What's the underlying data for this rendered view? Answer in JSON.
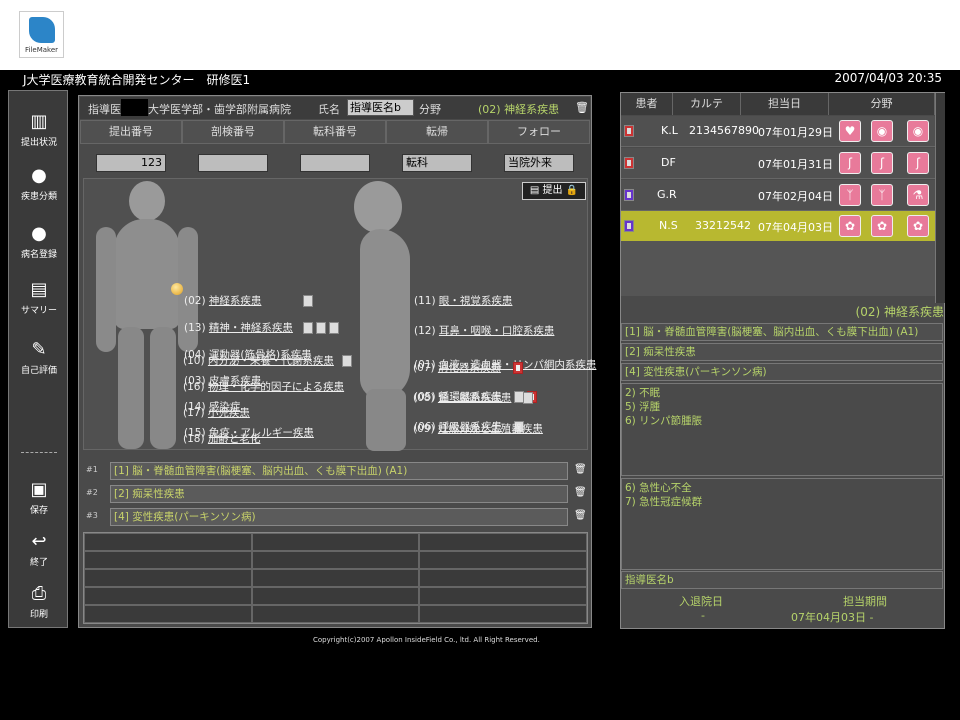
{
  "app": {
    "logo_text": "FileMaker",
    "title": "J大学医療教育統合開発センター　研修医1",
    "datetime": "2007/04/03 20:35"
  },
  "sidebar": [
    {
      "name": "submission-status",
      "label": "提出状況",
      "icon": "bar-chart-icon"
    },
    {
      "name": "disease-class",
      "label": "疾患分類",
      "icon": "people-icon"
    },
    {
      "name": "disease-register",
      "label": "病名登録",
      "icon": "person-icon"
    },
    {
      "name": "summary",
      "label": "サマリー",
      "icon": "document-icon"
    },
    {
      "name": "self-eval",
      "label": "自己評価",
      "icon": "pencil-doc-icon"
    },
    {
      "name": "save",
      "label": "保存",
      "icon": "floppy-icon"
    },
    {
      "name": "exit",
      "label": "終了",
      "icon": "return-arrow-icon"
    },
    {
      "name": "print",
      "label": "印刷",
      "icon": "printer-icon"
    }
  ],
  "header": {
    "supervisor_label": "指導医",
    "institution": "大学医学部・歯学部附属病院",
    "name_label": "氏名",
    "name_value": "指導医名b",
    "field_label": "分野",
    "field_value": "(02) 神経系疾患"
  },
  "columns": [
    "提出番号",
    "剖検番号",
    "転科番号",
    "転帰",
    "フォロー"
  ],
  "column_values": [
    "123",
    "",
    "",
    "転科",
    "当院外来"
  ],
  "submit_label": "提出",
  "categories_left": [
    {
      "label": "(02)",
      "text": "神経系疾患",
      "docs": 1
    },
    {
      "label": "(13)",
      "text": "精神・神経系疾患",
      "docs": 3
    },
    {
      "label": "(04)",
      "text": "運動器(筋骨格)系疾患",
      "docs": 0
    },
    {
      "label": "(03)",
      "text": "皮膚系疾患",
      "docs": 0
    },
    {
      "label": "(14)",
      "text": "感染症",
      "docs": 0
    },
    {
      "label": "(15)",
      "text": "免疫・アレルギー疾患",
      "docs": 0
    },
    {
      "label": "(10)",
      "text": "内分泌・栄養・代謝系疾患",
      "docs": 1
    },
    {
      "label": "(16)",
      "text": "物理・化学的因子による疾患",
      "docs": 0
    },
    {
      "label": "(17)",
      "text": "小児疾患",
      "docs": 0
    },
    {
      "label": "(18)",
      "text": "加齢と老化",
      "docs": 0
    }
  ],
  "categories_right": [
    {
      "label": "(11)",
      "text": "眼・視覚系疾患",
      "docs": 0
    },
    {
      "label": "(12)",
      "text": "耳鼻・咽喉・口腔系疾患",
      "docs": 0
    },
    {
      "label": "(01)",
      "text": "血液・造血器・リンパ網内系疾患",
      "docs": 0
    },
    {
      "label": "(05)",
      "text": "循環器系疾患",
      "docs": 2
    },
    {
      "label": "(06)",
      "text": "呼吸器系疾患",
      "docs": 1
    },
    {
      "label": "(07)",
      "text": "消化器系疾患",
      "docs": 1
    },
    {
      "label": "(08)",
      "text": "腎・尿路系疾患",
      "docs": 1
    },
    {
      "label": "(09)",
      "text": "妊娠分娩と生殖器疾患",
      "docs": 0
    }
  ],
  "diagnoses": [
    {
      "num": "#1",
      "text": "[1] 脳・脊髄血管障害(脳梗塞、脳内出血、くも膜下出血) (A1)"
    },
    {
      "num": "#2",
      "text": "[2] 痴呆性疾患"
    },
    {
      "num": "#3",
      "text": "[4] 変性疾患(パーキンソン病)"
    }
  ],
  "patients_header": [
    "患者",
    "カルテ",
    "担当日",
    "分野"
  ],
  "patients": [
    {
      "name": "K.L",
      "chart": "2134567890",
      "date": "07年01月29日",
      "icons": [
        "heart-icon",
        "brain-icon",
        "brain-icon"
      ],
      "check": "red"
    },
    {
      "name": "DF",
      "chart": "",
      "date": "07年01月31日",
      "icons": [
        "stomach-icon",
        "stomach-icon",
        "stomach-icon"
      ],
      "check": "red"
    },
    {
      "name": "G.R",
      "chart": "",
      "date": "07年02月04日",
      "icons": [
        "lungs-icon",
        "lungs-icon",
        "flask-icon"
      ],
      "check": "blue"
    },
    {
      "name": "N.S",
      "chart": "33212542",
      "date": "07年04月03日",
      "icons": [
        "virus-icon",
        "virus-icon",
        "virus-icon"
      ],
      "check": "blue",
      "selected": true
    }
  ],
  "right": {
    "category": "(02) 神経系疾患",
    "lines": [
      "[1] 脳・脊髄血管障害(脳梗塞、脳内出血、くも膜下出血) (A1)",
      "[2] 痴呆性疾患",
      "[4] 変性疾患(パーキンソン病)"
    ],
    "detail1": [
      "2) 不眠",
      "5) 浮腫",
      "6) リンパ節腫脹"
    ],
    "detail2": [
      "6) 急性心不全",
      "7) 急性冠症候群"
    ],
    "doctor": "指導医名b",
    "admit_label": "入退院日",
    "period_label": "担当期間",
    "admit_value": "-",
    "period_value": "07年04月03日 -"
  },
  "copyright": "Copyright(c)2007 Apollon InsideField Co., ltd. All Right Reserved."
}
